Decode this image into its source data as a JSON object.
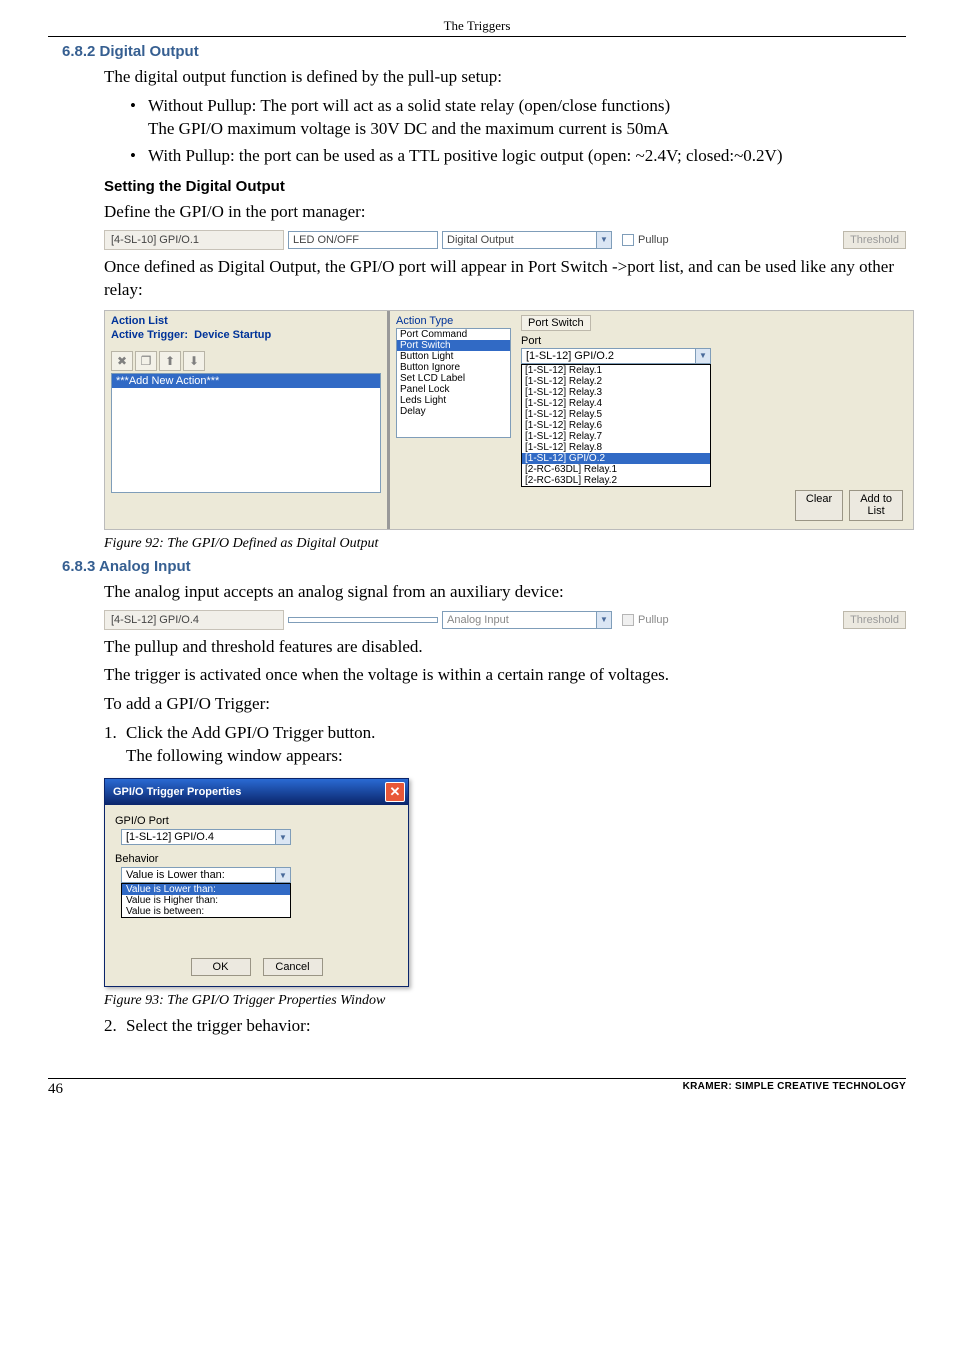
{
  "running_head": "The Triggers",
  "sec682": {
    "num": "6.8.2",
    "title": "Digital Output"
  },
  "p1": "The digital output function is defined by the pull-up setup:",
  "bul1a": "Without Pullup: The port will act as a solid state relay (open/close functions)",
  "bul1b": "The GPI/O maximum voltage is 30V DC and the maximum current is 50mA",
  "bul2": "With Pullup: the port can be used as a TTL positive logic output (open: ~2.4V; closed:~0.2V)",
  "h_setting": "Setting the Digital Output",
  "p2": "Define the GPI/O in the port manager:",
  "pm1": {
    "name": "[4-SL-10] GPI/O.1",
    "desc": "LED ON/OFF",
    "type": "Digital Output",
    "pullup_label": "Pullup",
    "threshold_label": "Threshold"
  },
  "p3": "Once defined as Digital Output, the GPI/O port will appear in Port Switch ->port list, and can be used like any other relay:",
  "fig92": {
    "al_title": "Action List",
    "al_sub_label": "Active Trigger:",
    "al_sub_val": "Device Startup",
    "add_new": "***Add New Action***",
    "at_label": "Action Type",
    "at_items": [
      "Port Command",
      "Port Switch",
      "Button Light",
      "Button Ignore",
      "Set LCD Label",
      "Panel Lock",
      "Leds Light",
      "Delay"
    ],
    "at_selected": "Port Switch",
    "ps_title": "Port Switch",
    "ps_port_label": "Port",
    "ps_selected": "[1-SL-12] GPI/O.2",
    "ps_items": [
      "[1-SL-12] Relay.1",
      "[1-SL-12] Relay.2",
      "[1-SL-12] Relay.3",
      "[1-SL-12] Relay.4",
      "[1-SL-12] Relay.5",
      "[1-SL-12] Relay.6",
      "[1-SL-12] Relay.7",
      "[1-SL-12] Relay.8",
      "[1-SL-12] GPI/O.2",
      "[2-RC-63DL] Relay.1",
      "[2-RC-63DL] Relay.2"
    ],
    "clear": "Clear",
    "addto": "Add to\nList"
  },
  "figcap92": "Figure 92: The GPI/O Defined as Digital Output",
  "sec683": {
    "num": "6.8.3",
    "title": "Analog Input"
  },
  "p4": "The analog input accepts an analog signal from an auxiliary device:",
  "pm2": {
    "name": "[4-SL-12] GPI/O.4",
    "desc": "",
    "type": "Analog Input",
    "pullup_label": "Pullup",
    "threshold_label": "Threshold"
  },
  "p5": "The pullup and threshold features are disabled.",
  "p6": "The trigger is activated once when the voltage is within a certain range of voltages.",
  "p7": "To add a GPI/O Trigger:",
  "step1a": "Click the Add GPI/O Trigger button.",
  "step1b": "The following window appears:",
  "dlg": {
    "title": "GPI/O Trigger Properties",
    "gpio_label": "GPI/O Port",
    "gpio_val": "[1-SL-12] GPI/O.4",
    "beh_label": "Behavior",
    "beh_val": "Value is Lower than:",
    "beh_items": [
      "Value is Lower than:",
      "Value is Higher than:",
      "Value is between:"
    ],
    "ok": "OK",
    "cancel": "Cancel"
  },
  "figcap93": "Figure 93: The GPI/O Trigger Properties Window",
  "step2": "Select the trigger behavior:",
  "footer": {
    "page": "46",
    "brand": "KRAMER:  SIMPLE CREATIVE TECHNOLOGY"
  }
}
